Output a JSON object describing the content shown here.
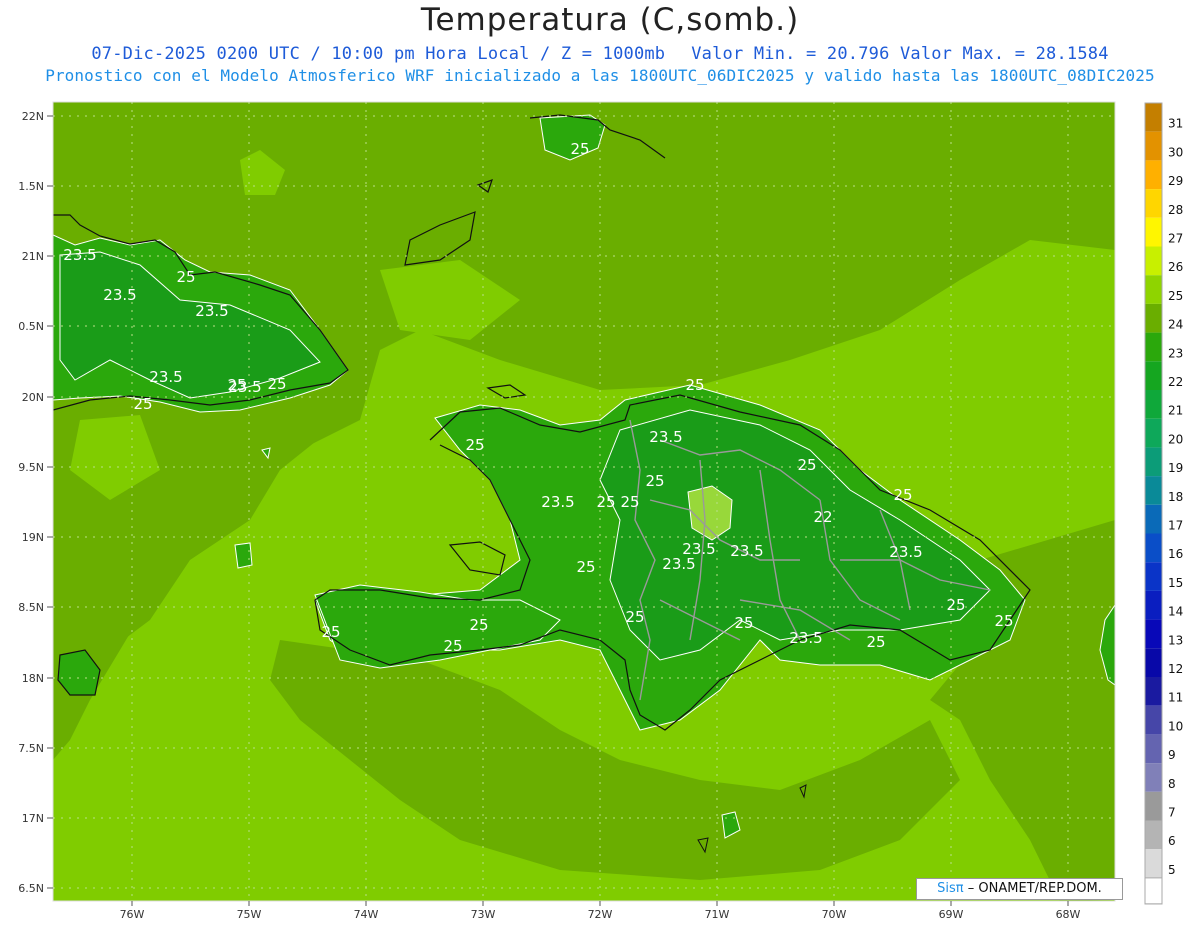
{
  "header": {
    "title": "Temperatura (C,somb.)",
    "line1_date": "07-Dic-2025 0200 UTC / 10:00 pm Hora Local / Z = 1000mb",
    "line1_minmax": "Valor Min. = 20.796  Valor Max. = 28.1584",
    "line2": "Pronostico con el Modelo Atmosferico WRF inicializado a las 1800UTC_06DIC2025 y valido hasta las  1800UTC_08DIC2025"
  },
  "map": {
    "lat_ticks": [
      "22N",
      "1.5N",
      "21N",
      "0.5N",
      "20N",
      "9.5N",
      "19N",
      "8.5N",
      "18N",
      "7.5N",
      "17N",
      "6.5N"
    ],
    "lon_ticks": [
      "76W",
      "75W",
      "74W",
      "73W",
      "72W",
      "71W",
      "70W",
      "69W",
      "68W"
    ],
    "contour_labels": [
      {
        "text": "25"
      },
      {
        "text": "23.5"
      },
      {
        "text": "25"
      },
      {
        "text": "23.5"
      },
      {
        "text": "23.5"
      },
      {
        "text": "23.5"
      },
      {
        "text": "25"
      },
      {
        "text": "25"
      },
      {
        "text": "25"
      },
      {
        "text": "25"
      },
      {
        "text": "23.5"
      },
      {
        "text": "25"
      },
      {
        "text": "25"
      },
      {
        "text": "23.5"
      },
      {
        "text": "25"
      },
      {
        "text": "25"
      },
      {
        "text": "25"
      },
      {
        "text": "22"
      },
      {
        "text": "23.5"
      },
      {
        "text": "23.5"
      },
      {
        "text": "23.5"
      },
      {
        "text": "23.5"
      },
      {
        "text": "25"
      },
      {
        "text": "25"
      },
      {
        "text": "25"
      },
      {
        "text": "25"
      },
      {
        "text": "25"
      },
      {
        "text": "25"
      },
      {
        "text": "25"
      },
      {
        "text": "23.5"
      },
      {
        "text": "25"
      },
      {
        "text": "25"
      },
      {
        "text": "25"
      },
      {
        "text": "23.5"
      }
    ]
  },
  "colorbar": {
    "labels": [
      "31",
      "30",
      "29",
      "28",
      "27",
      "26",
      "25",
      "24",
      "23",
      "22",
      "21",
      "20",
      "19",
      "18",
      "17",
      "16",
      "15",
      "14",
      "13",
      "12",
      "11",
      "10",
      "9",
      "8",
      "7",
      "6",
      "5"
    ],
    "colors": [
      "#c47f00",
      "#e39200",
      "#ffb000",
      "#ffd600",
      "#fff600",
      "#c8f000",
      "#8fd400",
      "#6aae00",
      "#2ba80c",
      "#15a620",
      "#0fa83a",
      "#0ea85a",
      "#0c9c78",
      "#0a8a98",
      "#0a6ab8",
      "#0a4ec8",
      "#0a34c8",
      "#0a1ec0",
      "#0808b8",
      "#0808a8",
      "#1a1aa0",
      "#4646a8",
      "#6464b0",
      "#8080b8",
      "#9a9a9a",
      "#b4b4b4",
      "#dadada"
    ]
  },
  "credit": {
    "brand": "Sisπ",
    "org": "– ONAMET/REP.DOM."
  },
  "colors": {
    "sea": "#80cc00",
    "sea_dark": "#6aae00",
    "land_low": "#2ba80c",
    "land_mid": "#1a9c18",
    "land_high": "#98d83a"
  }
}
